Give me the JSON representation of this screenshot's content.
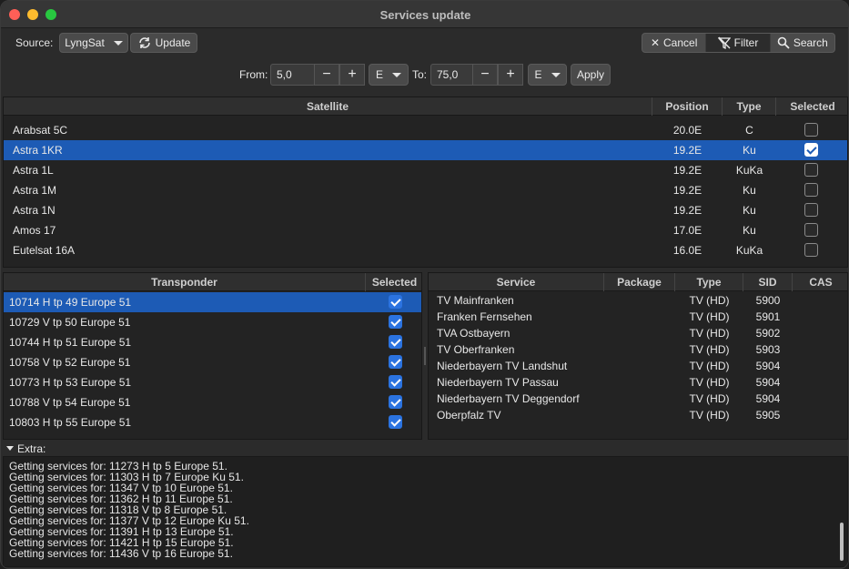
{
  "window": {
    "title": "Services update"
  },
  "toolbar": {
    "source_label": "Source:",
    "source_value": "LyngSat",
    "update_label": "Update",
    "cancel_label": "Cancel",
    "filter_label": "Filter",
    "search_label": "Search"
  },
  "range": {
    "from_label": "From:",
    "from_value": "5,0",
    "from_dir": "E",
    "to_label": "To:",
    "to_value": "75,0",
    "to_dir": "E",
    "minus": "−",
    "plus": "+",
    "apply_label": "Apply"
  },
  "satellites": {
    "headers": [
      "Satellite",
      "Position",
      "Type",
      "Selected"
    ],
    "rows": [
      {
        "name": "Arabsat 5C",
        "position": "20.0E",
        "type": "C",
        "selected": false
      },
      {
        "name": "Astra 1KR",
        "position": "19.2E",
        "type": "Ku",
        "selected": true,
        "highlight": true
      },
      {
        "name": "Astra 1L",
        "position": "19.2E",
        "type": "KuKa",
        "selected": false
      },
      {
        "name": "Astra 1M",
        "position": "19.2E",
        "type": "Ku",
        "selected": false
      },
      {
        "name": "Astra 1N",
        "position": "19.2E",
        "type": "Ku",
        "selected": false
      },
      {
        "name": "Amos 17",
        "position": "17.0E",
        "type": "Ku",
        "selected": false
      },
      {
        "name": "Eutelsat 16A",
        "position": "16.0E",
        "type": "KuKa",
        "selected": false
      }
    ]
  },
  "transponders": {
    "headers": [
      "Transponder",
      "Selected"
    ],
    "rows": [
      {
        "name": "10714 H tp 49 Europe 51",
        "selected": true,
        "highlight": true
      },
      {
        "name": "10729 V tp 50 Europe 51",
        "selected": true
      },
      {
        "name": "10744 H tp 51 Europe 51",
        "selected": true
      },
      {
        "name": "10758 V tp 52 Europe 51",
        "selected": true
      },
      {
        "name": "10773 H tp 53 Europe 51",
        "selected": true
      },
      {
        "name": "10788 V tp 54 Europe 51",
        "selected": true
      },
      {
        "name": "10803 H tp 55 Europe 51",
        "selected": true
      }
    ]
  },
  "services": {
    "headers": [
      "Service",
      "Package",
      "Type",
      "SID",
      "CAS"
    ],
    "rows": [
      {
        "name": "TV Mainfranken",
        "package": "",
        "type": "TV (HD)",
        "sid": "5900",
        "cas": ""
      },
      {
        "name": "Franken Fernsehen",
        "package": "",
        "type": "TV (HD)",
        "sid": "5901",
        "cas": ""
      },
      {
        "name": "TVA Ostbayern",
        "package": "",
        "type": "TV (HD)",
        "sid": "5902",
        "cas": ""
      },
      {
        "name": "TV Oberfranken",
        "package": "",
        "type": "TV (HD)",
        "sid": "5903",
        "cas": ""
      },
      {
        "name": "Niederbayern TV Landshut",
        "package": "",
        "type": "TV (HD)",
        "sid": "5904",
        "cas": ""
      },
      {
        "name": "Niederbayern TV Passau",
        "package": "",
        "type": "TV (HD)",
        "sid": "5904",
        "cas": ""
      },
      {
        "name": "Niederbayern TV Deggendorf",
        "package": "",
        "type": "TV (HD)",
        "sid": "5904",
        "cas": ""
      },
      {
        "name": "Oberpfalz TV",
        "package": "",
        "type": "TV (HD)",
        "sid": "5905",
        "cas": ""
      }
    ]
  },
  "extra": {
    "label": "Extra:",
    "log": [
      "Getting services for: 11273 H tp 5 Europe 51.",
      "Getting services for: 11303 H tp 7 Europe Ku 51.",
      "Getting services for: 11347 V tp 10 Europe 51.",
      "Getting services for: 11362 H tp 11 Europe 51.",
      "Getting services for: 11318 V tp 8 Europe 51.",
      "Getting services for: 11377 V tp 12 Europe Ku 51.",
      "Getting services for: 11391 H tp 13 Europe 51.",
      "Getting services for: 11421 H tp 15 Europe 51.",
      "Getting services for: 11436 V tp 16 Europe 51."
    ]
  },
  "colors": {
    "selection": "#1d5bb5",
    "checkbox_on": "#2b73e0"
  }
}
